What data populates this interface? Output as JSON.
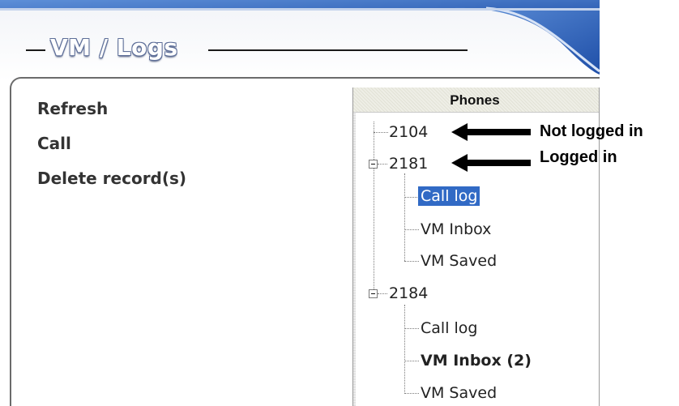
{
  "section": {
    "title": "VM / Logs"
  },
  "actions": [
    {
      "label": "Refresh"
    },
    {
      "label": "Call"
    },
    {
      "label": "Delete record(s)"
    }
  ],
  "tree": {
    "header": "Phones",
    "phones": [
      {
        "number": "2104",
        "logged_in": false,
        "children": []
      },
      {
        "number": "2181",
        "logged_in": true,
        "expanded": true,
        "children": [
          {
            "label": "Call log",
            "selected": true,
            "bold": false
          },
          {
            "label": "VM Inbox",
            "selected": false,
            "bold": false
          },
          {
            "label": "VM Saved",
            "selected": false,
            "bold": false
          }
        ]
      },
      {
        "number": "2184",
        "logged_in": true,
        "expanded": true,
        "children": [
          {
            "label": "Call log",
            "selected": false,
            "bold": false
          },
          {
            "label": "VM Inbox (2)",
            "selected": false,
            "bold": true
          },
          {
            "label": "VM Saved",
            "selected": false,
            "bold": false
          }
        ]
      }
    ]
  },
  "annotations": {
    "not_logged_in": "Not logged in",
    "logged_in": "Logged in"
  },
  "colors": {
    "header_blue": "#2f63b5",
    "selection": "#316ac5",
    "text": "#333333"
  },
  "icons": {
    "expander": "minus-box-icon",
    "arrow": "left-arrow-icon"
  }
}
